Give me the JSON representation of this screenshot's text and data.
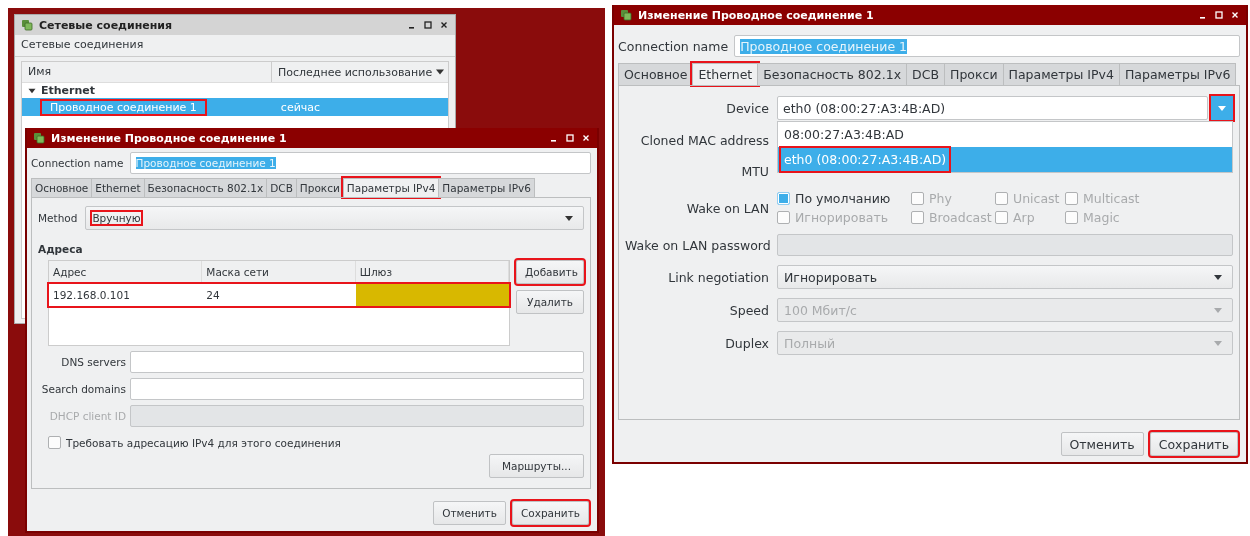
{
  "connections_window": {
    "title": "Сетевые соединения",
    "heading": "Сетевые соединения",
    "columns": [
      "Имя",
      "Последнее использование"
    ],
    "groups": [
      {
        "name": "Ethernet",
        "expanded": true,
        "children": [
          {
            "name": "Проводное соединение 1",
            "last_used": "сейчас",
            "selected": true,
            "highlighted": true
          }
        ]
      }
    ]
  },
  "ipv4_dialog": {
    "title": "Изменение Проводное соединение 1",
    "connection_name_label": "Connection name",
    "connection_name": "Проводное соединение 1",
    "connection_name_selected": true,
    "tabs": [
      {
        "label": "Основное",
        "selected": false,
        "highlighted": false
      },
      {
        "label": "Ethernet",
        "selected": false,
        "highlighted": false
      },
      {
        "label": "Безопасность 802.1x",
        "selected": false,
        "highlighted": false
      },
      {
        "label": "DCB",
        "selected": false,
        "highlighted": false
      },
      {
        "label": "Прокси",
        "selected": false,
        "highlighted": false
      },
      {
        "label": "Параметры IPv4",
        "selected": true,
        "highlighted": true
      },
      {
        "label": "Параметры IPv6",
        "selected": false,
        "highlighted": false
      }
    ],
    "method_label": "Method",
    "method": {
      "value": "Вручную",
      "highlighted": true
    },
    "addresses_heading": "Адреса",
    "address_columns": [
      "Адрес",
      "Маска сети",
      "Шлюз"
    ],
    "addresses": [
      {
        "address": "192.168.0.101",
        "netmask": "24",
        "gateway_error": true,
        "highlighted": true
      }
    ],
    "address_buttons": [
      {
        "label": "Добавить",
        "highlighted": true
      },
      {
        "label": "Удалить",
        "highlighted": false
      }
    ],
    "fields": [
      {
        "label": "DNS servers",
        "disabled": false
      },
      {
        "label": "Search domains",
        "disabled": false
      },
      {
        "label": "DHCP client ID",
        "disabled": true
      }
    ],
    "require_ipv4": {
      "label": "Требовать адресацию IPv4 для этого соединения",
      "checked": false
    },
    "routes_button": "Маршруты...",
    "buttons": [
      {
        "label": "Отменить",
        "highlighted": false
      },
      {
        "label": "Сохранить",
        "highlighted": true
      }
    ]
  },
  "ethernet_dialog": {
    "title": "Изменение Проводное соединение 1",
    "connection_name_label": "Connection name",
    "connection_name": "Проводное соединение 1",
    "connection_name_selected": true,
    "tabs": [
      {
        "label": "Основное",
        "selected": false,
        "highlighted": false
      },
      {
        "label": "Ethernet",
        "selected": true,
        "highlighted": true
      },
      {
        "label": "Безопасность 802.1x",
        "selected": false,
        "highlighted": false
      },
      {
        "label": "DCB",
        "selected": false,
        "highlighted": false
      },
      {
        "label": "Прокси",
        "selected": false,
        "highlighted": false
      },
      {
        "label": "Параметры IPv4",
        "selected": false,
        "highlighted": false
      },
      {
        "label": "Параметры IPv6",
        "selected": false,
        "highlighted": false
      }
    ],
    "device_label": "Device",
    "device": {
      "value": "eth0 (08:00:27:A3:4B:AD)",
      "expanded": true,
      "button_highlighted": true
    },
    "device_options": [
      {
        "label": "08:00:27:A3:4B:AD",
        "selected": false,
        "highlighted": false
      },
      {
        "label": "eth0 (08:00:27:A3:4B:AD)",
        "selected": true,
        "highlighted": true
      }
    ],
    "cloned_mac_label": "Cloned MAC address",
    "mtu_label": "MTU",
    "wake_on_lan_label": "Wake on LAN",
    "wake_on_lan_options": [
      {
        "label": "По умолчанию",
        "checked": true,
        "disabled": false
      },
      {
        "label": "Phy",
        "checked": false,
        "disabled": true
      },
      {
        "label": "Unicast",
        "checked": false,
        "disabled": true
      },
      {
        "label": "Multicast",
        "checked": false,
        "disabled": true
      },
      {
        "label": "Игнорировать",
        "checked": false,
        "disabled": true
      },
      {
        "label": "Broadcast",
        "checked": false,
        "disabled": true
      },
      {
        "label": "Arp",
        "checked": false,
        "disabled": true
      },
      {
        "label": "Magic",
        "checked": false,
        "disabled": true
      }
    ],
    "wol_password_label": "Wake on LAN password",
    "selects": [
      {
        "label": "Link negotiation",
        "value": "Игнорировать",
        "disabled": false
      },
      {
        "label": "Speed",
        "value": "100 Мбит/с",
        "disabled": true
      },
      {
        "label": "Duplex",
        "value": "Полный",
        "disabled": true
      }
    ],
    "buttons": [
      {
        "label": "Отменить",
        "highlighted": false
      },
      {
        "label": "Сохранить",
        "highlighted": true
      }
    ]
  }
}
